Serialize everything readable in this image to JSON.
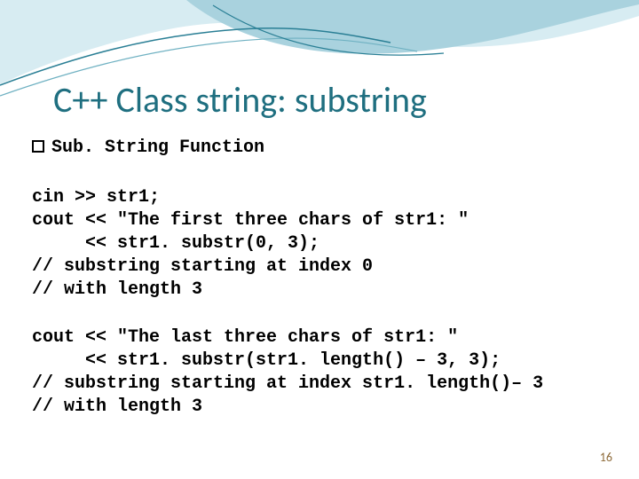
{
  "title": "C++ Class string: substring",
  "subheading": "Sub. String Function",
  "code_block_1": "cin >> str1;\ncout << \"The first three chars of str1: \"\n     << str1. substr(0, 3);\n// substring starting at index 0\n// with length 3",
  "code_block_2": "cout << \"The last three chars of str1: \"\n     << str1. substr(str1. length() – 3, 3);\n// substring starting at index str1. length()– 3\n// with length 3",
  "page_number": "16",
  "theme": {
    "title_color": "#1f6f80",
    "wave_light": "#bfe3ec",
    "wave_mid": "#7fb9c9",
    "wave_line": "#2a7f95"
  }
}
